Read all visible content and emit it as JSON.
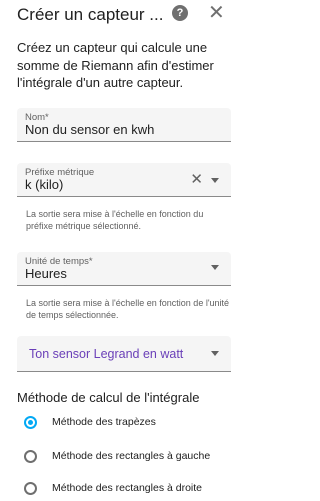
{
  "dialog": {
    "title": "Créer un capteur ...",
    "description": "Créez un capteur qui calcule une somme de Riemann afin d'estimer l'intégrale d'un autre capteur."
  },
  "colors": {
    "accent": "#03a9f4",
    "overlay_text": "#6a3fb8"
  },
  "icons": {
    "help": "help-icon",
    "close": "close-icon"
  },
  "fields": {
    "name": {
      "label": "Nom*",
      "value": "Non du sensor en kwh"
    },
    "metric_prefix": {
      "label": "Préfixe métrique",
      "value": "k (kilo)",
      "helper": "La sortie sera mise à l'échelle en fonction du préfixe métrique sélectionné."
    },
    "time_unit": {
      "label": "Unité de temps*",
      "value": "Heures",
      "helper": "La sortie sera mise à l'échelle en fonction de l'unité de temps sélectionnée."
    },
    "input_sensor": {
      "value": "Ton sensor Legrand en watt"
    }
  },
  "method": {
    "title": "Méthode de calcul de l'intégrale",
    "options": [
      {
        "label": "Méthode des trapèzes",
        "selected": true
      },
      {
        "label": "Méthode des rectangles à gauche",
        "selected": false
      },
      {
        "label": "Méthode des rectangles à droite",
        "selected": false
      }
    ]
  }
}
